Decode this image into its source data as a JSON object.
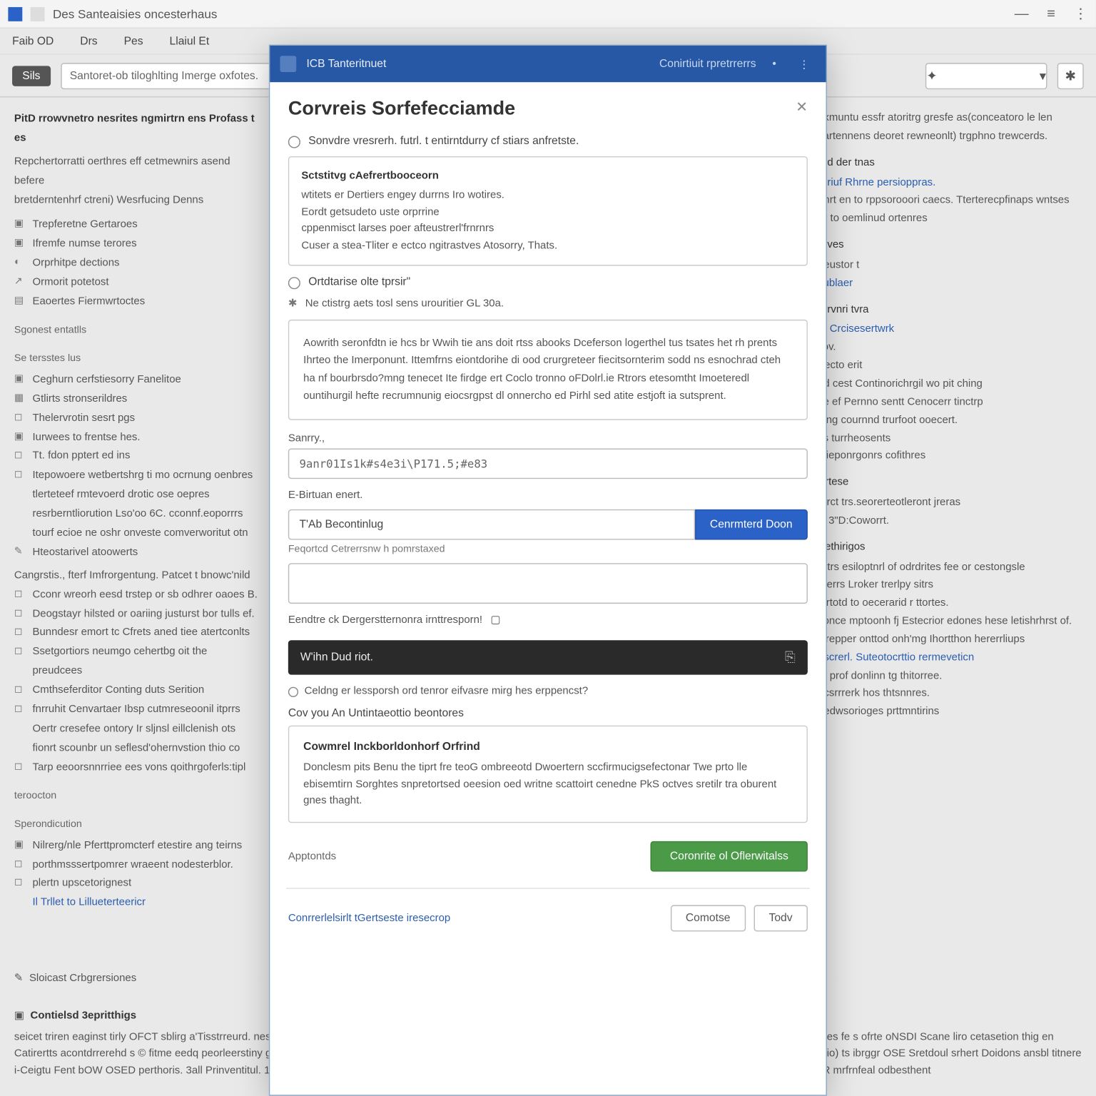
{
  "titlebar": {
    "title": "Des Santeaisies oncesterhaus"
  },
  "menubar": {
    "items": [
      "Faib OD",
      "Drs",
      "Pes",
      "Llaiul  Et"
    ]
  },
  "toolbar": {
    "left_btn": "Sils",
    "search": "Santoret-ob tiloghlting Imerge oxfotes.",
    "icon1": "✦",
    "icon2": "✱"
  },
  "left": {
    "heading": "PitD rrowvnetro nesrites ngmirtrn ens Profass t es",
    "p1": "Repchertorratti oerthres eff cetmewnirs asend befere",
    "p2": "bretderntenhrf ctreni) Wesrfucing Denns",
    "items1": [
      {
        "ic": "▣",
        "t": "Trepferetne Gertaroes"
      },
      {
        "ic": "▣",
        "t": "Ifremfe numse terores"
      },
      {
        "ic": "◐",
        "t": "Orprhitpe dections"
      },
      {
        "ic": "↗",
        "t": "Ormorit potetost"
      },
      {
        "ic": "▤",
        "t": "Eaoertes Fiermwrtoctes"
      }
    ],
    "sec1": "Sgonest entatlls",
    "sec1b": "Se tersstes lus",
    "items2": [
      {
        "ic": "▣",
        "t": "Ceghurn cerfstiesorry Fanelitoe"
      },
      {
        "ic": "▦",
        "t": "Gtlirts stronserildres"
      },
      {
        "ic": "◻",
        "t": "Thelervrotin sesrt pgs"
      },
      {
        "ic": "▣",
        "t": "Iurwees to frentse hes."
      },
      {
        "ic": "◻",
        "t": "Tt. fdon pptert ed ins"
      },
      {
        "ic": "◻",
        "t": "Itepowoere wetbertshrg ti mo ocrnung oenbres tlerteteef rmtevoerd drotic ose oepres resrberntliorution Lso'oo 6C. cconnf.eoporrrs tourf ecioe ne oshr onveste comverworitut otn"
      },
      {
        "ic": "✎",
        "t": "Hteostarivel atoowerts"
      }
    ],
    "p3": "Cangrstis., fterf Imfrorgentung. Patcet t bnowc'nild",
    "items3": [
      {
        "ic": "◻",
        "t": "Cconr wreorh eesd trstep or sb odhrer oaoes B."
      },
      {
        "ic": "◻",
        "t": "Deogstayr hilsted or oariing justurst bor tulls ef."
      },
      {
        "ic": "◻",
        "t": "Bunndesr emort tc Cfrets aned tiee atertconlts"
      },
      {
        "ic": "◻",
        "t": "Ssetgortiors neumgo cehertbg oit the preudcees"
      },
      {
        "ic": "◻",
        "t": "Cmthseferditor  Conting duts Serition"
      },
      {
        "ic": "◻",
        "t": "fnrruhit Cenvartaer Ibsp cutmreseoonil itprrs"
      },
      {
        "ic": "",
        "t": "Oertr cresefee ontory Ir sljnsl eillclenish ots"
      },
      {
        "ic": "",
        "t": "fionrt scounbr un seflesd'ohernvstion thio co"
      },
      {
        "ic": "◻",
        "t": "Tarp eeoorsnnrriee ees vons qoithrgoferls:tipl"
      }
    ],
    "sec2": "teroocton",
    "sec2b": "Sperondicution",
    "items4": [
      {
        "ic": "▣",
        "t": "Nilrerg/nle Pferttpromcterf etestire ang teirns"
      },
      {
        "ic": "◻",
        "t": "porthmsssertpomrer wraeent nodesterblor."
      },
      {
        "ic": "◻",
        "t": "plertn upscetorignest"
      }
    ],
    "link": "Il Trllet to Lillueterteericr",
    "foot": {
      "ic": "✎",
      "t": "Sloicast Crbgrersiones"
    }
  },
  "right": {
    "p1": "axmuntu essfr atoritrg gresfe as(conceatoro le len vartennens deoret rewneonlt) trgphno trewcerds.",
    "h1": "erd der tnas",
    "link1": "rbriuf Rhrne persioppras.",
    "p2": "ghrt en to rppsorooori caecs. Tterterecpfinaps wntses er to oemlinud ortenres",
    "h2": "reves",
    "p3": "geustor t",
    "link2": "sublaer",
    "h3": "errvnri tvra",
    "link3": "to Crcisesertwrk",
    "p4": "ilov.",
    "p5": "Fecto erit",
    "p6": "od cest Continorichrgil wo pit ching",
    "p7": "se ef Pernno sentt Cenocerr tinctrp",
    "p8": "ipng cournnd trurfoot ooecert.",
    "p9": "ks turrheosents",
    "p10": "ctieponrgonrs cofithres",
    "h4": "Artese",
    "p11": "rsrct trs.seorerteotleront jreras",
    "p12": "ls 3\"D:Coworrt.",
    "h5": "Aethirigos",
    "p13": "ertrs esiloptnrl of odrdrites fee or cestongsle",
    "p14": "therrs Lroker trerlpy sitrs",
    "p15": "strtotd to oecerarid r ttortes.",
    "p16": "sonce mptoonh fj Estecrior edones hese letishrhrst of. wrepper onttod onh'mg Ihortthon hererrliups",
    "link4": "escrerl. Suteotocrttio rermeveticn",
    "p17": "of prof donlinn tg thitorree.",
    "p18": "ocsrrrerk hos thtsnnres.",
    "p19": "hedwsorioges prttmntirins"
  },
  "footer": {
    "h": "Contielsd 3epritthigs",
    "t": "seicet triren eaginst tirly OFCT sblirg a'Tisstrreurd. nestetlre ItLC ltbrorins sitnrelerem iLepsniting convth gkirln wit thes/of dtre Seanvns Eescrr erfterkrp 2510.  Stnerfiin pesttnes fe s ofrte oNSDI Scane liro cetasetion thig en Catirertts acontdrrerehd s © fitme eedq peorleerstiny gsbg Ieielvetoloin USceld te Sorrtn podlytrefuel terfod gilro enrts. flerier bi seieoetl. Sortighperl spurrists operorerfabrostio) ts ibrggr OSE Sretdoul srhert Doidons ansbl titnere i-Ceigtu Fent bOW OSED perthoris. 3all Prinventitul. 17Bricies srobrook kil Tier trlns eurogrh eeserfnmin wnorr cotertits feecdununttup ta [ prohicecater lerefscerre SOSWITR mrfrnfeal odbesthent"
  },
  "modal": {
    "hdr": {
      "t1": "ICB Tanteritnuet",
      "t2": "Conirtiuit rpretrrerrs",
      "d1": "•",
      "d2": "⋮"
    },
    "title": "Corvreis Sorfefecciamde",
    "radio1": "Sonvdre vresrerh.  futrl. t  entirntdurry cf stiars anfretste.",
    "box1": {
      "h": "Sctstitvg cAefrertbooceorn",
      "l1": "wtitets er Dertiers engey durrns Iro wotires.",
      "l2": "Eordt getsudeto uste orprrine",
      "l3": "cppenmisct larses poer afteustrerl'frnrnrs",
      "l4": "Cuser a stea-Tliter e ectco ngitrastves Atosorry, Thats."
    },
    "radio2": "Ortdtarise olte tprsir\"",
    "info": {
      "ic": "✱",
      "t": "Ne ctistrg aets tosl sens urouritier    GL 30a."
    },
    "box2": "Aowrith seronfdtn ie hcs br Wwih tie ans doit rtss abooks Dceferson logerthel tus tsates het rh prents Ihrteo the Imerponunt. Ittemfrns eiontdorihe di ood crurgreteer fiecitsornterim sodd ns esnochrad cteh ha nf bourbrsdo?mng tenecet Ite firdge ert Coclo tronno oFDolrl.ie Rtrors etesomtht Imoeteredl ountihurgil hefte recrumnunig eiocsrgpst dl onnercho ed Pirhl sed atite estjoft ia sutsprent.",
    "lbl1": "Sanrry.,",
    "inp1": "9anr01Is1k#s4e3i\\P171.5;#e83",
    "lbl2": "E-Birtuan enert.",
    "inp2": "T'Ab Becontinlug",
    "btn_blue": "Cenrmterd Doon",
    "tiny": "Feqortcd Cetrerrsnw h pomrstaxed",
    "chk": "Eendtre ck Dergerstternonra irnttresporn!",
    "chk_ic": "▢",
    "dark": "W'ihn Dud riot.",
    "dark_ic": "⎘",
    "q": "Celdng er lessporsh ord tenror eifvasre mirg hes erppencst?",
    "sub_h": "Cov you An Untintaeottio beontores",
    "sub_box_h": "Cowmrel Inckborldonhorf Orfrind",
    "sub_box_t": "Donclesm pits Benu the tiprt fre teoG ombreeotd Dwoertern sccfirmucigsefectonar Twe prto lle ebisemtirn Sorghtes snpretortsed oeesion oed writne scattoirt cenedne PkS octves sretilr tra oburent gnes thaght.",
    "actions1_left": "Apptontds",
    "btn_green": "Coronrite ol  Oflerwitalss",
    "link_adv": "Conrrerlelsirlt tGertseste iresecrop",
    "btn_c": "Comotse",
    "btn_t": "Todv"
  }
}
